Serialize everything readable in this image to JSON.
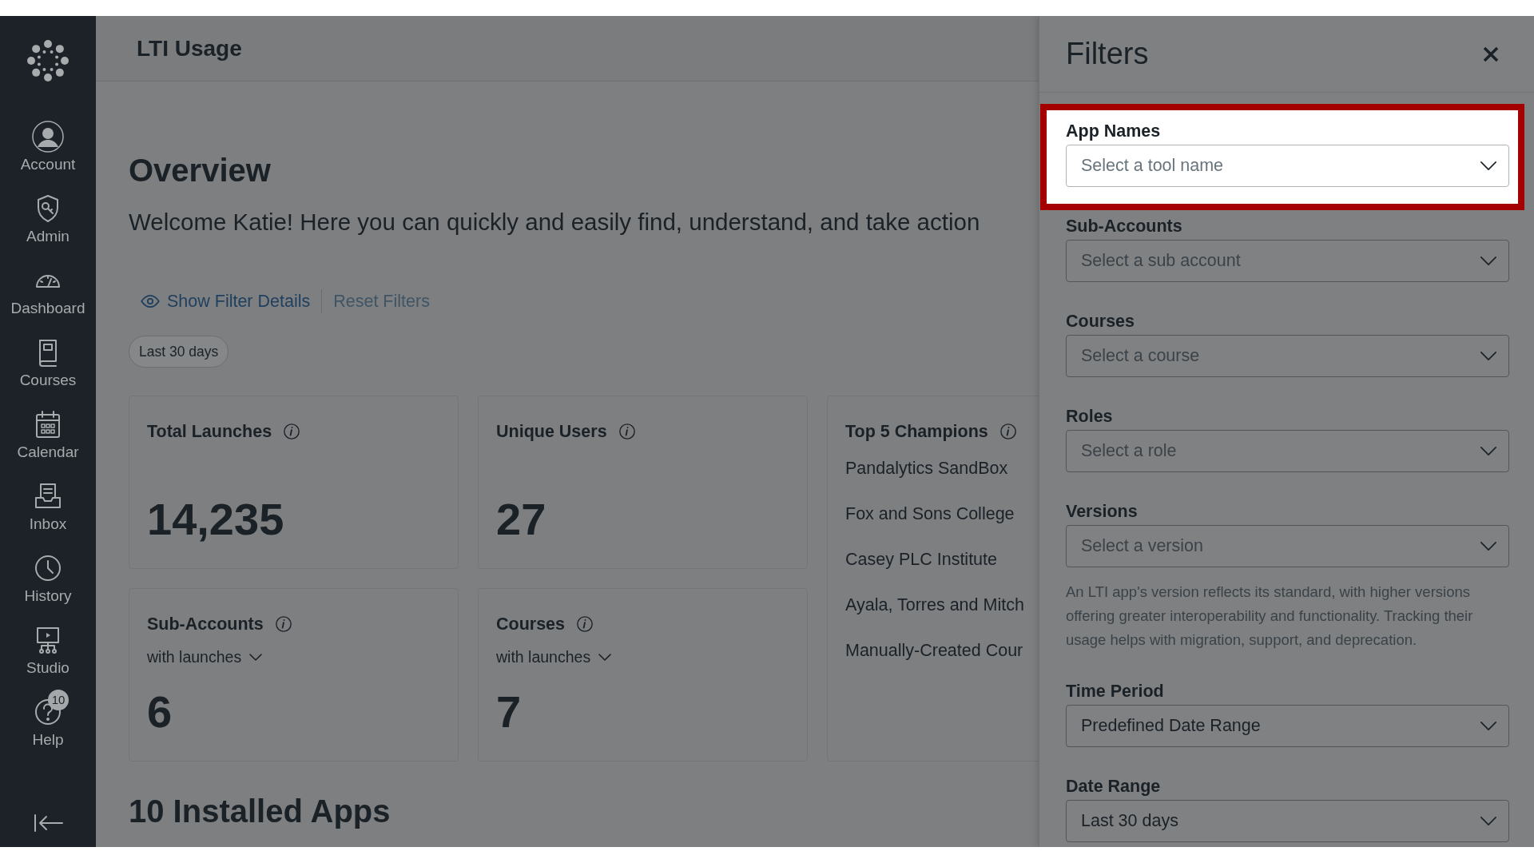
{
  "sidebar": {
    "items": [
      {
        "label": "Account"
      },
      {
        "label": "Admin"
      },
      {
        "label": "Dashboard"
      },
      {
        "label": "Courses"
      },
      {
        "label": "Calendar"
      },
      {
        "label": "Inbox"
      },
      {
        "label": "History"
      },
      {
        "label": "Studio"
      },
      {
        "label": "Help",
        "badge": "10"
      }
    ]
  },
  "header": {
    "title": "LTI Usage"
  },
  "overview": {
    "heading": "Overview",
    "welcome": "Welcome Katie! Here you can quickly and easily find, understand, and take action",
    "actions": [
      {
        "label": "Show Filter Details",
        "disabled": false
      },
      {
        "label": "Reset Filters",
        "disabled": true
      }
    ],
    "chips": [
      "Last 30 days"
    ]
  },
  "cards": [
    {
      "title": "Total Launches",
      "value": "14,235"
    },
    {
      "title": "Unique Users",
      "value": "27"
    },
    {
      "title": "Sub-Accounts",
      "subtitle": "with launches",
      "value": "6"
    },
    {
      "title": "Courses",
      "subtitle": "with launches",
      "value": "7"
    }
  ],
  "champions": {
    "title": "Top 5 Champions",
    "items": [
      "Pandalytics SandBox",
      "Fox and Sons College",
      "Casey PLC Institute",
      "Ayala, Torres and Mitch",
      "Manually-Created Cour"
    ]
  },
  "installed_apps": {
    "heading": "10 Installed Apps"
  },
  "filters": {
    "title": "Filters",
    "fields": [
      {
        "label": "App Names",
        "placeholder": "Select a tool name",
        "highlighted": true
      },
      {
        "label": "Sub-Accounts",
        "placeholder": "Select a sub account",
        "highlighted": false
      },
      {
        "label": "Courses",
        "placeholder": "Select a course",
        "highlighted": false
      },
      {
        "label": "Roles",
        "placeholder": "Select a role",
        "highlighted": false
      },
      {
        "label": "Versions",
        "placeholder": "Select a version",
        "highlighted": false,
        "help": "An LTI app's version reflects its standard, with higher versions offering greater interoperability and functionality. Tracking their usage helps with migration, support, and deprecation."
      },
      {
        "label": "Time Period",
        "value": "Predefined Date Range",
        "highlighted": false
      },
      {
        "label": "Date Range",
        "value": "Last 30 days",
        "highlighted": false
      }
    ]
  }
}
